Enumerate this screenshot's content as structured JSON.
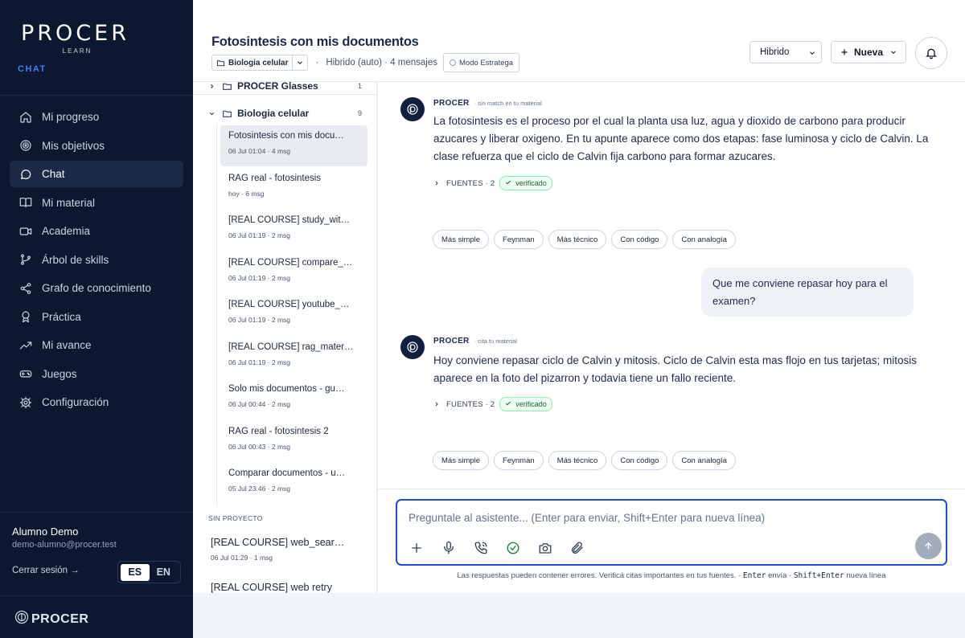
{
  "brand": {
    "logo_text": "PROCER",
    "logo_sub": "LEARN",
    "section": "CHAT",
    "footer_logo": "PROCER"
  },
  "sidebar": {
    "items": [
      {
        "label": "Mi progreso",
        "icon": "home-icon"
      },
      {
        "label": "Mis objetivos",
        "icon": "target-icon"
      },
      {
        "label": "Chat",
        "icon": "chat-bubble-icon",
        "active": true
      },
      {
        "label": "Mi material",
        "icon": "book-icon"
      },
      {
        "label": "Academia",
        "icon": "video-icon"
      },
      {
        "label": "Árbol de skills",
        "icon": "git-branch-icon"
      },
      {
        "label": "Grafo de conocimiento",
        "icon": "share-graph-icon"
      },
      {
        "label": "Práctica",
        "icon": "award-icon"
      },
      {
        "label": "Mi avance",
        "icon": "trending-up-icon"
      },
      {
        "label": "Juegos",
        "icon": "gamepad-icon"
      },
      {
        "label": "Configuración",
        "icon": "gear-icon"
      }
    ],
    "user_name": "Alumno Demo",
    "user_email": "demo-alumno@procer.test",
    "logout": "Cerrar sesión →",
    "lang_es": "ES",
    "lang_en": "EN",
    "lang_selected": "ES"
  },
  "header": {
    "title": "Fotosintesis con mis documentos",
    "project": "Biologia celular",
    "separator": "·",
    "meta": "Hibrido (auto) · 4 mensajes",
    "strategy_mode": "Modo Estratega",
    "mode_select": "Hibrido",
    "new_button": "Nueva"
  },
  "conversations": {
    "folders": [
      {
        "name": "PROCER Glasses",
        "count": "1",
        "expanded": false
      },
      {
        "name": "Biologia celular",
        "count": "9",
        "expanded": true
      }
    ],
    "items": [
      {
        "title": "Fotosintesis con mis docu…",
        "meta": "06 Jul 01:04 · 4 msg",
        "active": true
      },
      {
        "title": "RAG real - fotosintesis",
        "meta": "hoy · 6 msg"
      },
      {
        "title": "[REAL COURSE] study_wit…",
        "meta": "06 Jul 01:19 · 2 msg"
      },
      {
        "title": "[REAL COURSE] compare_…",
        "meta": "06 Jul 01:19 · 2 msg"
      },
      {
        "title": "[REAL COURSE] youtube_…",
        "meta": "06 Jul 01:19 · 2 msg"
      },
      {
        "title": "[REAL COURSE] rag_mater…",
        "meta": "06 Jul 01:19 · 2 msg"
      },
      {
        "title": "Solo mis documentos - gu…",
        "meta": "06 Jul 00:44 · 2 msg"
      },
      {
        "title": "RAG real - fotosintesis 2",
        "meta": "06 Jul 00:43 · 2 msg"
      },
      {
        "title": "Comparar documentos - u…",
        "meta": "05 Jul 23:46 · 2 msg"
      }
    ],
    "no_project_label": "SIN PROYECTO",
    "loose": [
      {
        "title": "[REAL COURSE] web_sear…",
        "meta": "06 Jul 01:29 · 1 msg"
      },
      {
        "title": "[REAL COURSE] web retry",
        "meta": ""
      }
    ]
  },
  "messages": [
    {
      "role": "assistant",
      "sender": "PROCER",
      "tag": "· sin match en tu material",
      "text": "La fotosintesis es el proceso por el cual la planta usa luz, agua y dioxido de carbono para producir azucares y liberar oxigeno. En tu apunte aparece como dos etapas: fase luminosa y ciclo de Calvin. La clase refuerza que el ciclo de Calvin fija carbono para formar azucares.",
      "sources": "FUENTES · 2",
      "verified": "verificado"
    },
    {
      "role": "user",
      "text": "Que me conviene repasar hoy para el examen?"
    },
    {
      "role": "assistant",
      "sender": "PROCER",
      "tag": "· cita tu material",
      "text": "Hoy conviene repasar ciclo de Calvin y mitosis. Ciclo de Calvin esta mas flojo en tus tarjetas; mitosis aparece en la foto del pizarron y todavia tiene un fallo reciente.",
      "sources": "FUENTES · 2",
      "verified": "verificado"
    }
  ],
  "chips": [
    "Más simple",
    "Feynman",
    "Más técnico",
    "Con código",
    "Con analogía"
  ],
  "composer": {
    "placeholder": "Preguntale al asistente... (Enter para enviar, Shift+Enter para nueva línea)",
    "disclaimer_prefix": "Las respuestas pueden contener errores. Verificá citas importantes en tus fuentes. ·",
    "key_enter": "Enter",
    "sends": "envía ·",
    "key_shift_enter": "Shift+Enter",
    "new_line": "nueva línea"
  },
  "colors": {
    "sidebar_bg": "#0c1730",
    "accent": "#1d4ed8",
    "section_label": "#3b82f6",
    "verified_border": "#86efac"
  }
}
